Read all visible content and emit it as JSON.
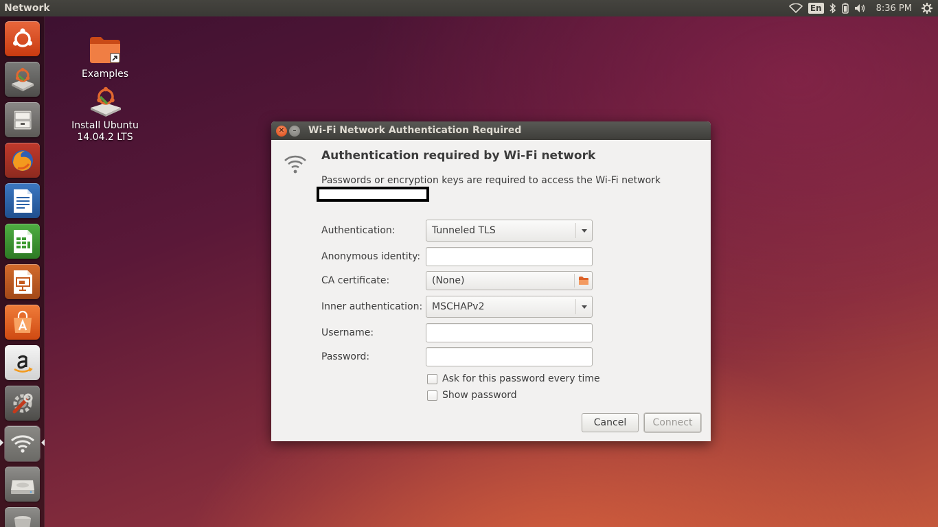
{
  "top_panel": {
    "app_title": "Network",
    "language": "En",
    "clock": "8:36 PM",
    "icons": [
      "wifi-icon",
      "keyboard-language-icon",
      "bluetooth-icon",
      "battery-icon",
      "volume-icon",
      "session-gear-icon"
    ]
  },
  "launcher": {
    "items": [
      {
        "name": "dash-home",
        "icon": "ubuntu-logo-icon"
      },
      {
        "name": "install-ubuntu",
        "icon": "installer-icon"
      },
      {
        "name": "files",
        "icon": "file-cabinet-icon"
      },
      {
        "name": "firefox",
        "icon": "firefox-icon"
      },
      {
        "name": "libreoffice-writer",
        "icon": "writer-icon"
      },
      {
        "name": "libreoffice-calc",
        "icon": "calc-icon"
      },
      {
        "name": "libreoffice-impress",
        "icon": "impress-icon"
      },
      {
        "name": "ubuntu-software-center",
        "icon": "shopping-bag-icon"
      },
      {
        "name": "amazon",
        "icon": "amazon-icon"
      },
      {
        "name": "system-settings",
        "icon": "settings-wrench-icon"
      },
      {
        "name": "network",
        "icon": "wifi-icon",
        "active": true
      },
      {
        "name": "disk-drive",
        "icon": "hard-drive-icon"
      },
      {
        "name": "trash",
        "icon": "trash-icon"
      }
    ]
  },
  "desktop": {
    "icons": [
      {
        "label": "Examples",
        "icon": "folder-icon"
      },
      {
        "label_line1": "Install Ubuntu",
        "label_line2": "14.04.2 LTS",
        "icon": "installer-icon"
      }
    ]
  },
  "dialog": {
    "window_title": "Wi-Fi Network Authentication Required",
    "heading": "Authentication required by Wi-Fi network",
    "description": "Passwords or encryption keys are required to access the Wi-Fi network",
    "form": {
      "authentication_label": "Authentication:",
      "authentication_value": "Tunneled TLS",
      "anonymous_identity_label": "Anonymous identity:",
      "anonymous_identity_value": "",
      "ca_certificate_label": "CA certificate:",
      "ca_certificate_value": "(None)",
      "inner_authentication_label": "Inner authentication:",
      "inner_authentication_value": "MSCHAPv2",
      "username_label": "Username:",
      "username_value": "",
      "password_label": "Password:",
      "password_value": "",
      "ask_password_label": "Ask for this password every time",
      "ask_password_checked": false,
      "show_password_label": "Show password",
      "show_password_checked": false
    },
    "buttons": {
      "cancel": "Cancel",
      "connect": "Connect"
    }
  },
  "colors": {
    "ubuntu_orange": "#dd4814",
    "panel_bg": "#3c3b37",
    "dialog_bg": "#f2f1f0"
  }
}
